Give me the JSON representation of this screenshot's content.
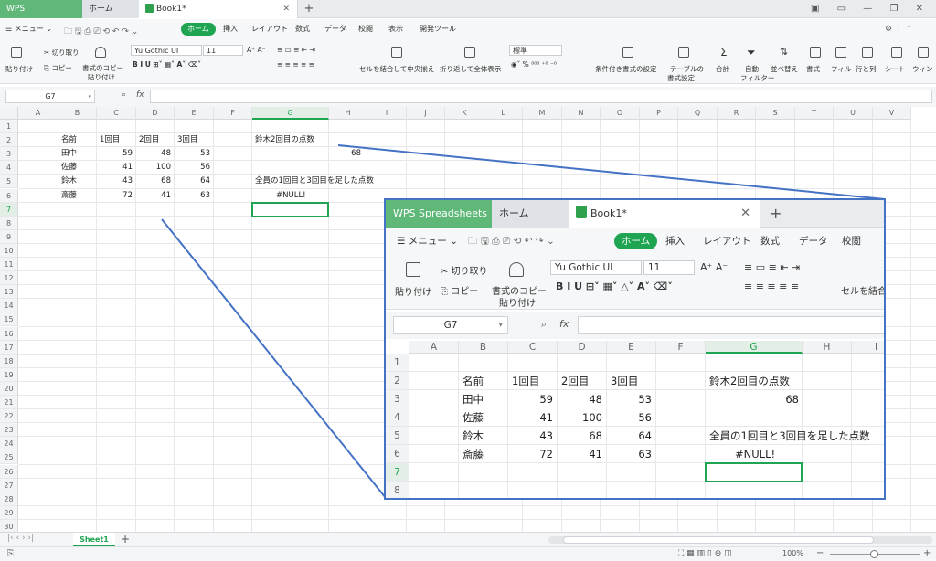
{
  "app": {
    "brand": "WPS Spreadsheets",
    "home_tab": "ホーム",
    "doc_tab": "Book1*"
  },
  "menu": {
    "menu_label": "メニュー",
    "items": [
      "ホーム",
      "挿入",
      "レイアウト",
      "数式",
      "データ",
      "校閲",
      "表示",
      "開発ツール"
    ]
  },
  "ribbon": {
    "paste": "貼り付け",
    "cut": "切り取り",
    "copy": "コピー",
    "format_copy": "書式のコピー",
    "format_copy2": "貼り付け",
    "font": "Yu Gothic UI",
    "size": "11",
    "merge": "セルを結合して中央揃え",
    "wrap": "折り返して全体表示",
    "num_format": "標準",
    "cond_format": "条件付き書式の設定",
    "table_format": "テーブルの",
    "table_format2": "書式設定",
    "sum": "合計",
    "autofilter": "自動",
    "autofilter2": "フィルター",
    "sort": "並べ替え",
    "format": "書式",
    "fill": "フィル",
    "rowcol": "行と列",
    "sheet": "シート",
    "window": "ウィン"
  },
  "formula_bar": {
    "name_box": "G7",
    "fx": "fx",
    "content": ""
  },
  "columns": [
    "A",
    "B",
    "C",
    "D",
    "E",
    "F",
    "G",
    "H",
    "I",
    "J",
    "K",
    "L",
    "M",
    "N",
    "O",
    "P",
    "Q",
    "R",
    "S",
    "T",
    "U",
    "V"
  ],
  "rows": [
    "1",
    "2",
    "3",
    "4",
    "5",
    "6",
    "7",
    "8",
    "9",
    "10",
    "11",
    "12",
    "13",
    "14",
    "15",
    "16",
    "17",
    "18",
    "19",
    "20",
    "21",
    "22",
    "23",
    "24",
    "25",
    "26",
    "27",
    "28",
    "29",
    "30"
  ],
  "cells": {
    "B2": "名前",
    "C2": "1回目",
    "D2": "2回目",
    "E2": "3回目",
    "B3": "田中",
    "C3": "59",
    "D3": "48",
    "E3": "53",
    "B4": "佐藤",
    "C4": "41",
    "D4": "100",
    "E4": "56",
    "B5": "鈴木",
    "C5": "43",
    "D5": "68",
    "E5": "64",
    "B6": "斎藤",
    "C6": "72",
    "D6": "41",
    "E6": "63",
    "G2": "鈴木2回目の点数",
    "G3": "68",
    "G5": "全員の1回目と3回目を足した点数",
    "G6": "#NULL!"
  },
  "sheet_tab": "Sheet1",
  "status": {
    "zoom": "100%"
  },
  "colors": {
    "accent": "#1fa452",
    "wps_tab": "#5fb878",
    "callout": "#4472c4"
  }
}
